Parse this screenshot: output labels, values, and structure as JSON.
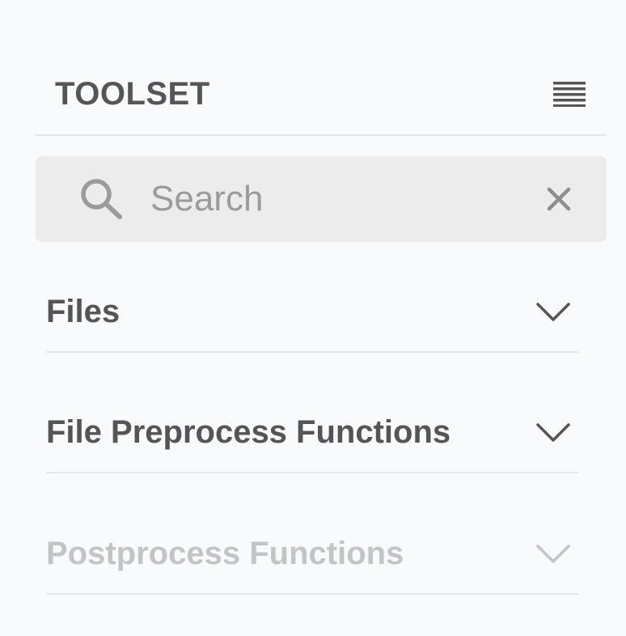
{
  "header": {
    "title": "TOOLSET",
    "menu_icon": "hamburger-menu-icon"
  },
  "search": {
    "placeholder": "Search",
    "value": "",
    "search_icon": "search-icon",
    "clear_icon": "close-icon"
  },
  "sections": [
    {
      "label": "Files",
      "icon": "chevron-down-icon",
      "state": "enabled"
    },
    {
      "label": "File Preprocess Functions",
      "icon": "chevron-down-icon",
      "state": "enabled"
    },
    {
      "label": "Postprocess Functions",
      "icon": "chevron-down-icon",
      "state": "disabled"
    }
  ],
  "colors": {
    "background": "#f9fafc",
    "text": "#555555",
    "disabled_text": "#c4c4c4",
    "search_background": "#ececec",
    "divider": "#e3e5e8",
    "placeholder": "#9b9b9b"
  }
}
